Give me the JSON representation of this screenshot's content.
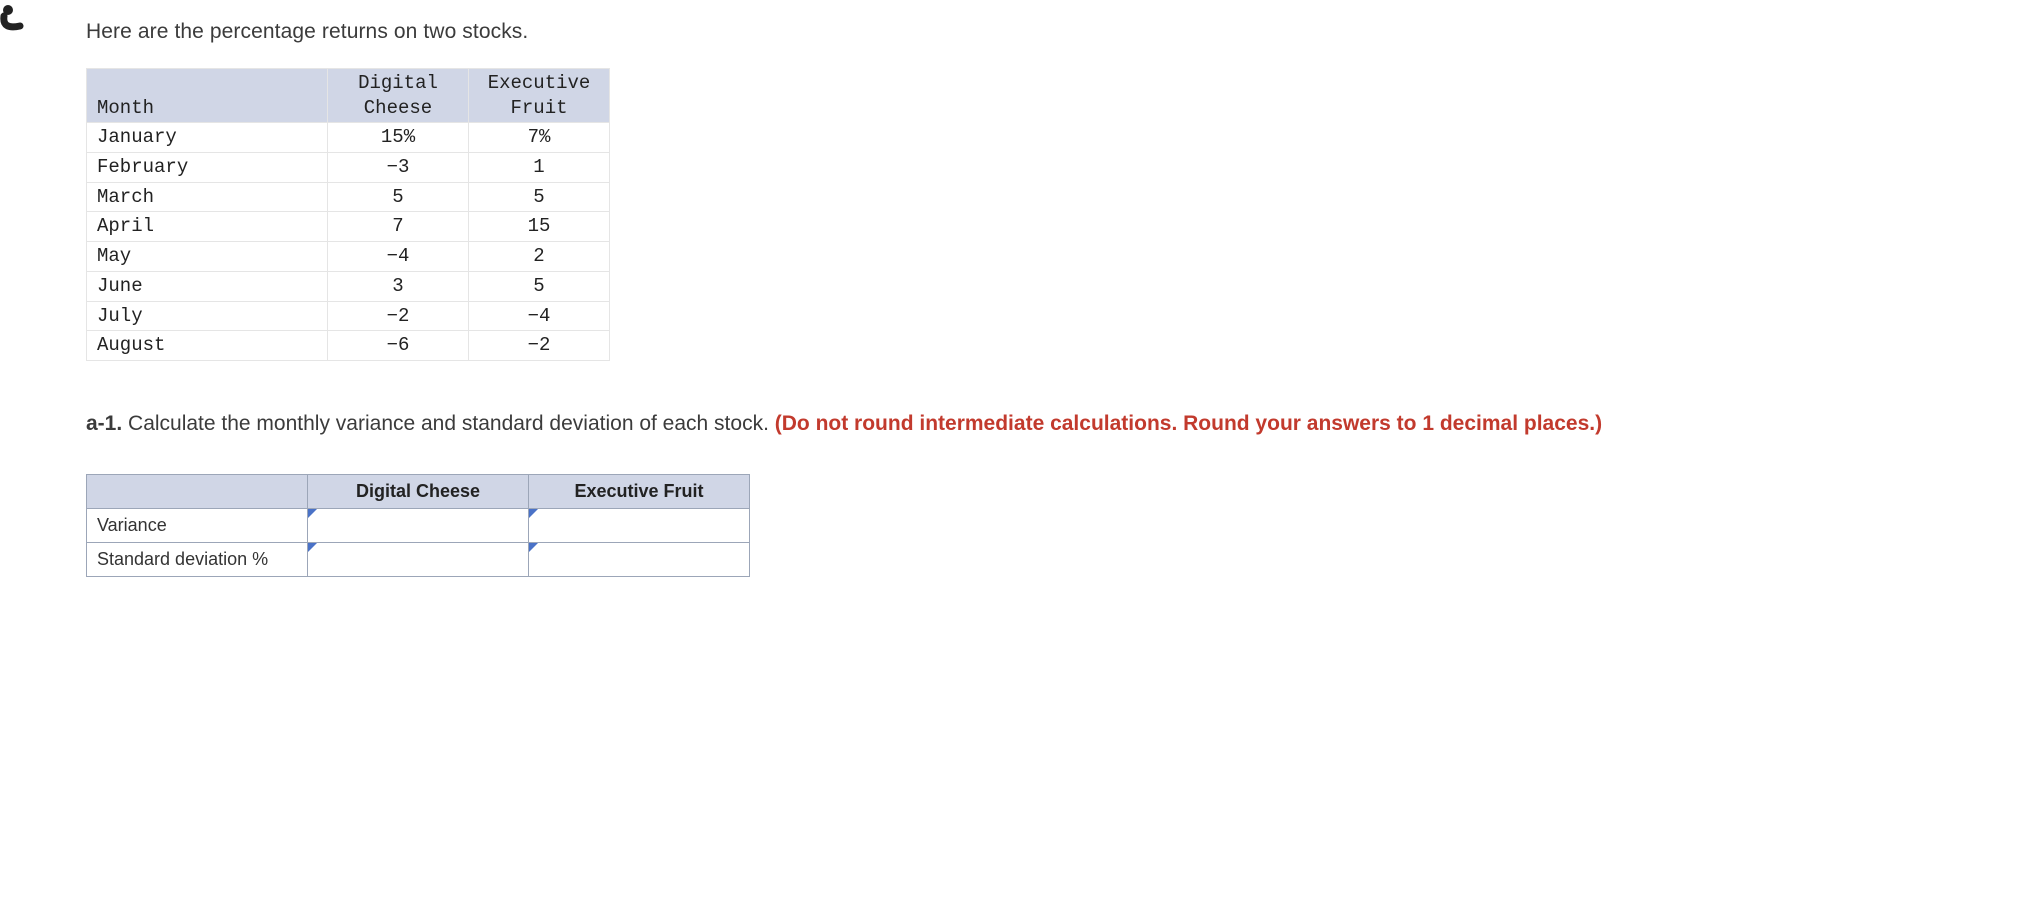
{
  "intro": "Here are the percentage returns on two stocks.",
  "chart_data": {
    "type": "table",
    "columns": [
      "Month",
      "Digital Cheese",
      "Executive Fruit"
    ],
    "rows": [
      {
        "month": "January",
        "digital": "15%",
        "fruit": "7%"
      },
      {
        "month": "February",
        "digital": "−3",
        "fruit": "1"
      },
      {
        "month": "March",
        "digital": "5",
        "fruit": "5"
      },
      {
        "month": "April",
        "digital": "7",
        "fruit": "15"
      },
      {
        "month": "May",
        "digital": "−4",
        "fruit": "2"
      },
      {
        "month": "June",
        "digital": "3",
        "fruit": "5"
      },
      {
        "month": "July",
        "digital": "−2",
        "fruit": "−4"
      },
      {
        "month": "August",
        "digital": "−6",
        "fruit": "−2"
      }
    ]
  },
  "question": {
    "prefix": "a-1.",
    "body": " Calculate the monthly variance and standard deviation of each stock. ",
    "emph": "(Do not round intermediate calculations. Round your answers to 1 decimal places.)"
  },
  "answer_table": {
    "headers": {
      "blank": "",
      "col1": "Digital Cheese",
      "col2": "Executive Fruit"
    },
    "rows": {
      "variance": "Variance",
      "stddev": "Standard deviation %"
    }
  }
}
